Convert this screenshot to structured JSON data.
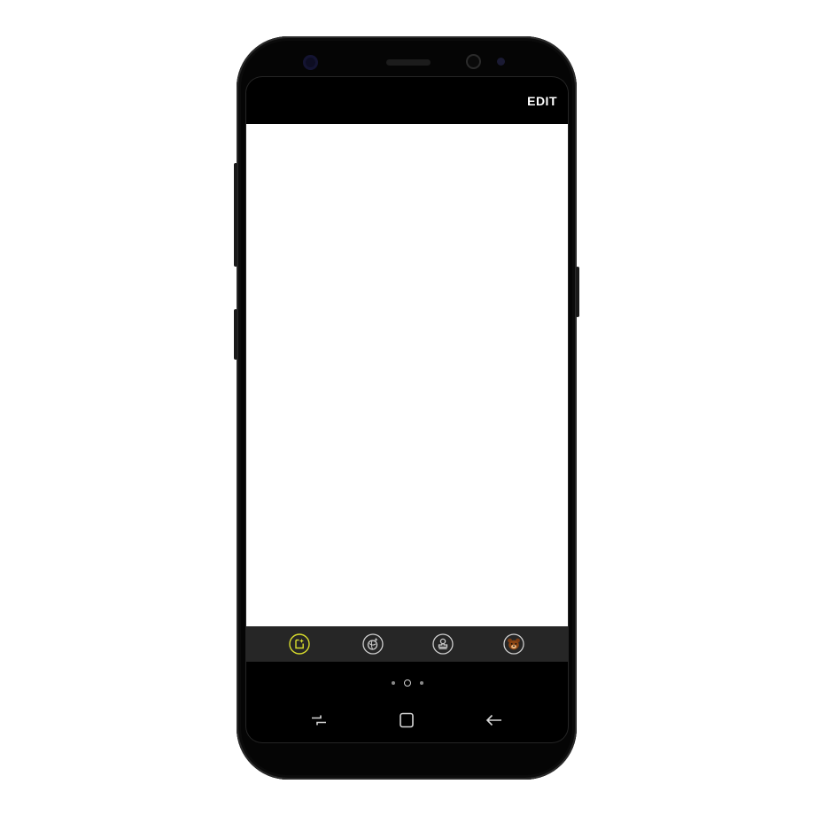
{
  "header": {
    "edit_label": "EDIT"
  },
  "toolbar": {
    "items": [
      {
        "icon": "image-edit-icon",
        "selected": true,
        "accent": "#d8dc2c"
      },
      {
        "icon": "sparkle-globe-icon",
        "selected": false
      },
      {
        "icon": "stamp-icon",
        "selected": false
      },
      {
        "icon": "bear-face-icon",
        "selected": false
      }
    ]
  },
  "pager": {
    "count": 3,
    "active_index": 1
  },
  "navigation": {
    "buttons": [
      "recent-apps-icon",
      "home-icon",
      "back-icon"
    ]
  },
  "colors": {
    "accent": "#d8dc2c",
    "toolbar_bg": "#262626",
    "bar_bg": "#000000"
  }
}
